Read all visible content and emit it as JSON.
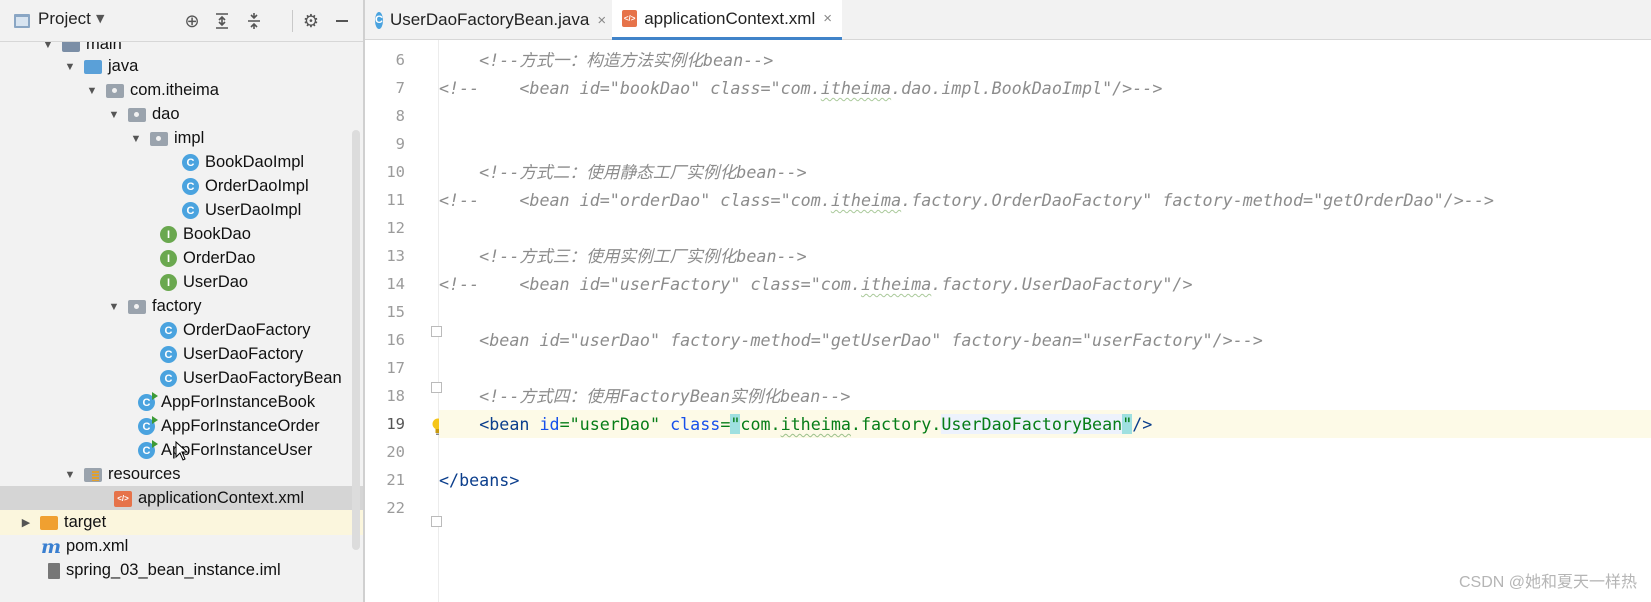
{
  "project_panel": {
    "title": "Project",
    "toolbar_icons": [
      "locate-icon",
      "expand-all-icon",
      "collapse-all-icon",
      "gear-icon",
      "minimize-icon"
    ],
    "tree": [
      {
        "label": "main",
        "icon": "folder-icon",
        "arrow": "expanded",
        "indent": 0
      },
      {
        "label": "java",
        "icon": "source-folder-icon",
        "arrow": "expanded",
        "indent": 1
      },
      {
        "label": "com.itheima",
        "icon": "package-icon",
        "arrow": "expanded",
        "indent": 2
      },
      {
        "label": "dao",
        "icon": "package-icon",
        "arrow": "expanded",
        "indent": 3
      },
      {
        "label": "impl",
        "icon": "package-icon",
        "arrow": "expanded",
        "indent": 4
      },
      {
        "label": "BookDaoImpl",
        "icon": "class-icon",
        "arrow": "none",
        "indent": 5
      },
      {
        "label": "OrderDaoImpl",
        "icon": "class-icon",
        "arrow": "none",
        "indent": 5
      },
      {
        "label": "UserDaoImpl",
        "icon": "class-icon",
        "arrow": "none",
        "indent": 5
      },
      {
        "label": "BookDao",
        "icon": "interface-icon",
        "arrow": "none",
        "indent": 4
      },
      {
        "label": "OrderDao",
        "icon": "interface-icon",
        "arrow": "none",
        "indent": 4
      },
      {
        "label": "UserDao",
        "icon": "interface-icon",
        "arrow": "none",
        "indent": 4
      },
      {
        "label": "factory",
        "icon": "package-icon",
        "arrow": "expanded",
        "indent": 3
      },
      {
        "label": "OrderDaoFactory",
        "icon": "class-icon",
        "arrow": "none",
        "indent": 4
      },
      {
        "label": "UserDaoFactory",
        "icon": "class-icon",
        "arrow": "none",
        "indent": 4
      },
      {
        "label": "UserDaoFactoryBean",
        "icon": "class-icon",
        "arrow": "none",
        "indent": 4
      },
      {
        "label": "AppForInstanceBook",
        "icon": "main-class-icon",
        "arrow": "none",
        "indent": 3
      },
      {
        "label": "AppForInstanceOrder",
        "icon": "main-class-icon",
        "arrow": "none",
        "indent": 3
      },
      {
        "label": "AppForInstanceUser",
        "icon": "main-class-icon",
        "arrow": "none",
        "indent": 3
      },
      {
        "label": "resources",
        "icon": "resources-folder-icon",
        "arrow": "expanded",
        "indent": 1
      },
      {
        "label": "applicationContext.xml",
        "icon": "xml-file-icon",
        "arrow": "none",
        "indent": 2,
        "selected": true
      },
      {
        "label": "target",
        "icon": "excluded-folder-icon",
        "arrow": "collapsed",
        "indent": -1,
        "highlighted": true
      },
      {
        "label": "pom.xml",
        "icon": "maven-icon",
        "arrow": "none",
        "indent": -1
      },
      {
        "label": "spring_03_bean_instance.iml",
        "icon": "module-file-icon",
        "arrow": "none",
        "indent": -1
      }
    ]
  },
  "editor": {
    "tabs": [
      {
        "label": "UserDaoFactoryBean.java",
        "icon": "java-class-icon",
        "active": false
      },
      {
        "label": "applicationContext.xml",
        "icon": "xml-file-icon",
        "active": true
      }
    ],
    "close_glyph": "×",
    "line_numbers": [
      "6",
      "7",
      "8",
      "9",
      "10",
      "11",
      "12",
      "13",
      "14",
      "15",
      "16",
      "17",
      "18",
      "19",
      "20",
      "21",
      "22"
    ],
    "current_line": "19",
    "code": {
      "l6": "    <!--方式一：构造方法实例化bean-->",
      "l7_open": "<!--    <bean id=\"bookDao\" class=\"com.",
      "l7_ul": "itheima",
      "l7_rest": ".dao.impl.BookDaoImpl\"/>-->",
      "l10": "    <!--方式二：使用静态工厂实例化bean-->",
      "l11_open": "<!--    <bean id=\"orderDao\" class=\"com.",
      "l11_ul": "itheima",
      "l11_rest": ".factory.OrderDaoFactory\" factory-method=\"getOrderDao\"/>-->",
      "l13": "    <!--方式三：使用实例工厂实例化bean-->",
      "l14_open": "<!--    <bean id=\"userFactory\" class=\"com.",
      "l14_ul": "itheima",
      "l14_rest": ".factory.UserDaoFactory\"/>",
      "l16": "    <bean id=\"userDao\" factory-method=\"getUserDao\" factory-bean=\"userFactory\"/>-->",
      "l18": "    <!--方式四：使用FactoryBean实例化bean-->",
      "l19": {
        "indent": "    ",
        "tag_open": "<bean",
        "attr1": "id",
        "eq1": "=",
        "val1": "\"userDao\"",
        "attr2": "class",
        "eq2": "=",
        "q_open": "\"",
        "val2_a": "com.",
        "val2_ul": "itheima",
        "val2_b": ".factory.",
        "val2_ref": "UserDaoFactoryBean",
        "q_close": "\"",
        "tag_close": "/>"
      },
      "l21": "</beans>"
    }
  },
  "watermark": "CSDN @她和夏天一样热"
}
